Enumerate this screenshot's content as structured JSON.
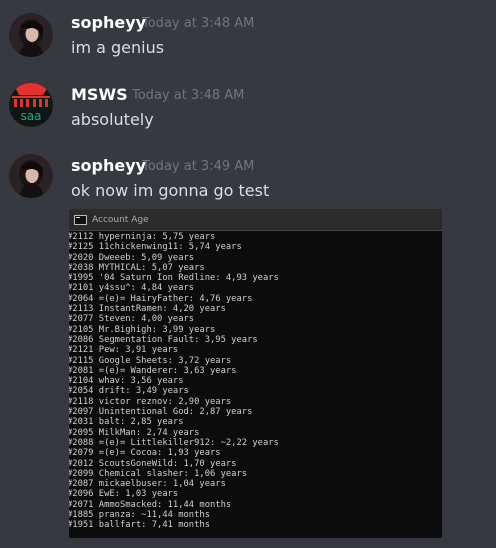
{
  "messages": [
    {
      "author": "sopheyy",
      "timestamp": "Today at 3:48 AM",
      "content": "im a genius"
    },
    {
      "author": "MSWS",
      "timestamp": "Today at 3:48 AM",
      "content": "absolutely"
    },
    {
      "author": "sopheyy",
      "timestamp": "Today at 3:49 AM",
      "content": "ok now im gonna go test"
    }
  ],
  "attachment": {
    "window_title": "Account Age",
    "lines": [
      "#2112 hyperninja: 5,75 years",
      "#2125 11chickenwing11: 5,74 years",
      "#2020 Dweeeb: 5,09 years",
      "#2038 MYTHICAL: 5,07 years",
      "#1995 '04 Saturn Ion Redline: 4,93 years",
      "#2101 y4ssu^: 4,84 years",
      "#2064 =(e)= HairyFather: 4,76 years",
      "#2113 InstantRamen: 4,20 years",
      "#2077 Steven: 4,00 years",
      "#2105 Mr.Bighigh: 3,99 years",
      "#2086 Segmentation Fault: 3,95 years",
      "#2121 Pew: 3,91 years",
      "#2115 Google Sheets: 3,72 years",
      "#2081 =(e)= Wanderer: 3,63 years",
      "#2104 whav: 3,56 years",
      "#2054 drift: 3,49 years",
      "#2118 victor reznov: 2,90 years",
      "#2097 Unintentional God: 2,87 years",
      "#2031 balt: 2,85 years",
      "#2095 MilkMan: 2,74 years",
      "#2088 =(e)= Littlekiller912: ~2,22 years",
      "#2079 =(e)= Cocoa: 1,93 years",
      "#2012 ScoutsGoneWild: 1,70 years",
      "#2099 Chemical slasher: 1,06 years",
      "#2087 mickaelbuser: 1,04 years",
      "#2096 EwE: 1,03 years",
      "#2071 AmmoSmacked: 11,44 months",
      "#1885 pranza: ~11,44 months",
      "#1951 ballfart: 7,41 months"
    ]
  },
  "avatars": {
    "sopheyy": {
      "icon": "user-avatar-photo-icon",
      "bg": "#2a2225"
    },
    "msws": {
      "icon": "msws-avatar-icon",
      "text_top": "MSWS",
      "text_bottom": "saa",
      "bg": "#101a14",
      "accent": "#e5322e",
      "accent2": "#1faa88"
    }
  },
  "colors": {
    "background": "#36393f",
    "username": "#ffffff",
    "timestamp": "#72767d",
    "message_text": "#dcddde",
    "console_bg": "#0c0c0c",
    "console_text": "#d0d0d0"
  }
}
